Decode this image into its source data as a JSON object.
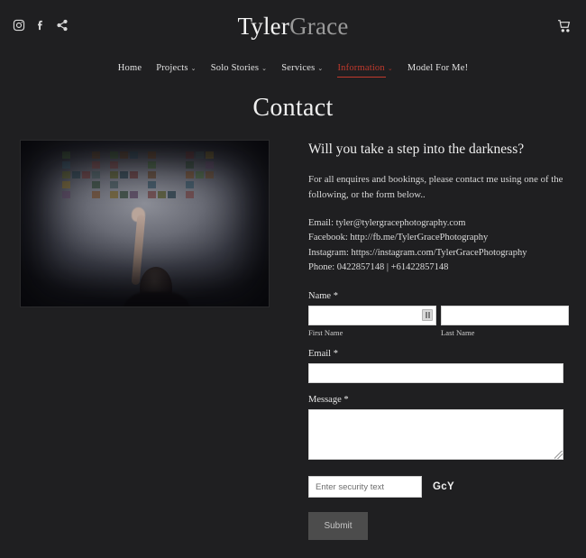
{
  "header": {
    "brand_first": "Tyler",
    "brand_second": "Grace",
    "social": [
      {
        "name": "instagram-icon",
        "label": "Instagram"
      },
      {
        "name": "facebook-icon",
        "label": "Facebook"
      },
      {
        "name": "share-icon",
        "label": "Share"
      }
    ],
    "cart_label": "Cart"
  },
  "nav": {
    "items": [
      {
        "label": "Home",
        "caret": "",
        "active": false
      },
      {
        "label": "Projects",
        "caret": "⌄",
        "active": false
      },
      {
        "label": "Solo Stories",
        "caret": "⌄",
        "active": false
      },
      {
        "label": "Services",
        "caret": "⌄",
        "active": false
      },
      {
        "label": "Information",
        "caret": "⌄",
        "active": true
      },
      {
        "label": "Model For Me!",
        "caret": "",
        "active": false
      }
    ],
    "active_color": "#c1392c"
  },
  "page": {
    "title": "Contact"
  },
  "photo": {
    "alt_text": "HELP",
    "letters": "HELP"
  },
  "main": {
    "heading": "Will you take a step into the darkness?",
    "paragraph": "For all enquires and bookings, please contact me using one of the following, or the form below..",
    "contact": {
      "email": "Email: tyler@tylergracephotography.com",
      "facebook": "Facebook: http://fb.me/TylerGracePhotography",
      "instagram": "Instagram: https://instagram.com/TylerGracePhotography",
      "phone": "Phone: 0422857148  | +61422857148"
    }
  },
  "form": {
    "name_label": "Name *",
    "first_name_value": "",
    "first_name_placeholder": "",
    "first_name_sublabel": "First Name",
    "last_name_value": "",
    "last_name_placeholder": "",
    "last_name_sublabel": "Last Name",
    "email_label": "Email *",
    "email_value": "",
    "email_placeholder": "",
    "message_label": "Message *",
    "message_value": "",
    "message_placeholder": "",
    "captcha_placeholder": "Enter security text",
    "captcha_value": "",
    "captcha_text": "GcY",
    "submit_label": "Submit"
  }
}
